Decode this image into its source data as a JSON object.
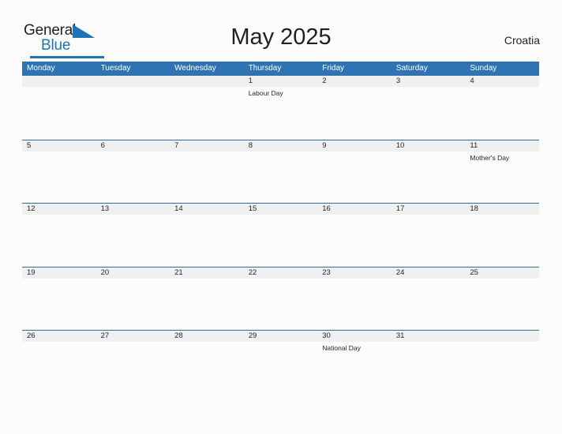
{
  "brand": {
    "name_part1": "General",
    "name_part2": "Blue",
    "flag_icon": "blue-triangle-flag-icon",
    "accent_color": "#1b75bc"
  },
  "header": {
    "title": "May 2025",
    "region": "Croatia"
  },
  "colors": {
    "header_blue": "#2e74b5",
    "row_rule_blue": "#2e6da8",
    "stripe_gray": "#f0f0f0",
    "page_background": "#fcfcfc",
    "text": "#231f20"
  },
  "calendar": {
    "weekday_headers": [
      "Monday",
      "Tuesday",
      "Wednesday",
      "Thursday",
      "Friday",
      "Saturday",
      "Sunday"
    ],
    "weeks": [
      [
        {
          "day": "",
          "event": ""
        },
        {
          "day": "",
          "event": ""
        },
        {
          "day": "",
          "event": ""
        },
        {
          "day": "1",
          "event": "Labour Day"
        },
        {
          "day": "2",
          "event": ""
        },
        {
          "day": "3",
          "event": ""
        },
        {
          "day": "4",
          "event": ""
        }
      ],
      [
        {
          "day": "5",
          "event": ""
        },
        {
          "day": "6",
          "event": ""
        },
        {
          "day": "7",
          "event": ""
        },
        {
          "day": "8",
          "event": ""
        },
        {
          "day": "9",
          "event": ""
        },
        {
          "day": "10",
          "event": ""
        },
        {
          "day": "11",
          "event": "Mother's Day"
        }
      ],
      [
        {
          "day": "12",
          "event": ""
        },
        {
          "day": "13",
          "event": ""
        },
        {
          "day": "14",
          "event": ""
        },
        {
          "day": "15",
          "event": ""
        },
        {
          "day": "16",
          "event": ""
        },
        {
          "day": "17",
          "event": ""
        },
        {
          "day": "18",
          "event": ""
        }
      ],
      [
        {
          "day": "19",
          "event": ""
        },
        {
          "day": "20",
          "event": ""
        },
        {
          "day": "21",
          "event": ""
        },
        {
          "day": "22",
          "event": ""
        },
        {
          "day": "23",
          "event": ""
        },
        {
          "day": "24",
          "event": ""
        },
        {
          "day": "25",
          "event": ""
        }
      ],
      [
        {
          "day": "26",
          "event": ""
        },
        {
          "day": "27",
          "event": ""
        },
        {
          "day": "28",
          "event": ""
        },
        {
          "day": "29",
          "event": ""
        },
        {
          "day": "30",
          "event": "National Day"
        },
        {
          "day": "31",
          "event": ""
        },
        {
          "day": "",
          "event": ""
        }
      ]
    ]
  }
}
